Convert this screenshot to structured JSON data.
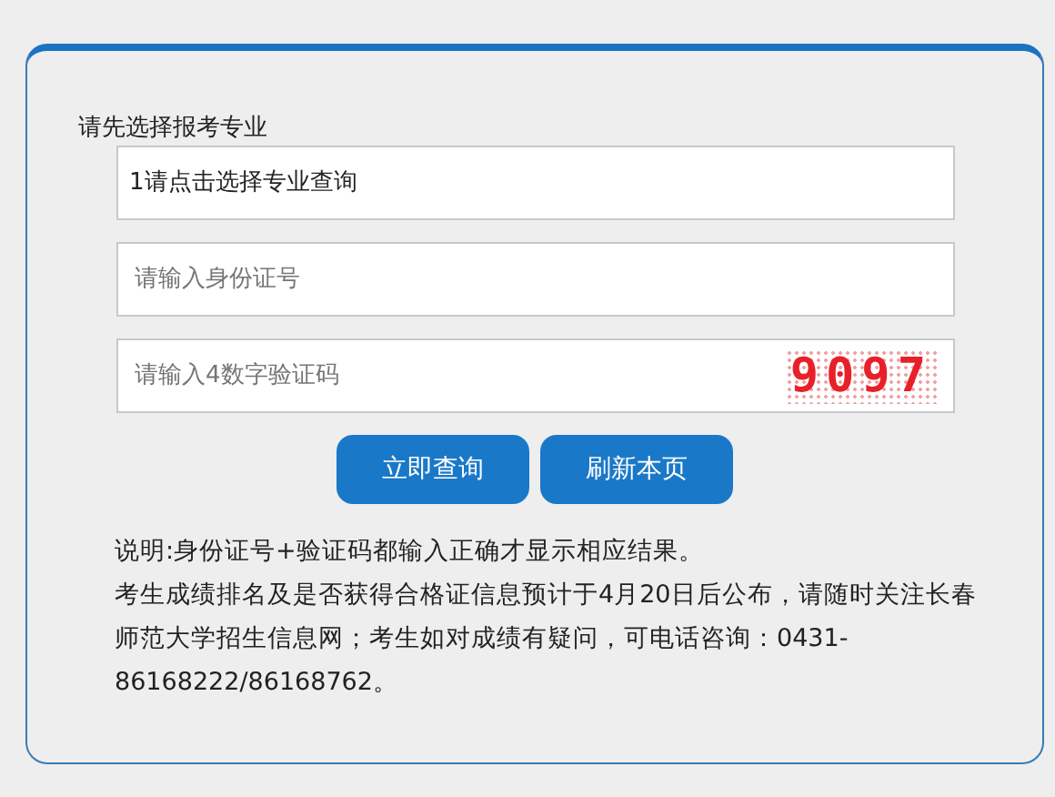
{
  "form": {
    "label": "请先选择报考专业",
    "major_select": {
      "value": "1请点击选择专业查询"
    },
    "id_field": {
      "placeholder": "请输入身份证号"
    },
    "captcha_field": {
      "placeholder": "请输入4数字验证码",
      "captcha": "9097"
    },
    "buttons": [
      {
        "label": "立即查询"
      },
      {
        "label": "刷新本页"
      }
    ],
    "notes": [
      "说明:身份证号+验证码都输入正确才显示相应结果。",
      "考生成绩排名及是否获得合格证信息预计于4月20日后公布，请随时关注长春师范大学招生信息网；考生如对成绩有疑问，可电话咨询：0431-86168222/86168762。"
    ]
  }
}
